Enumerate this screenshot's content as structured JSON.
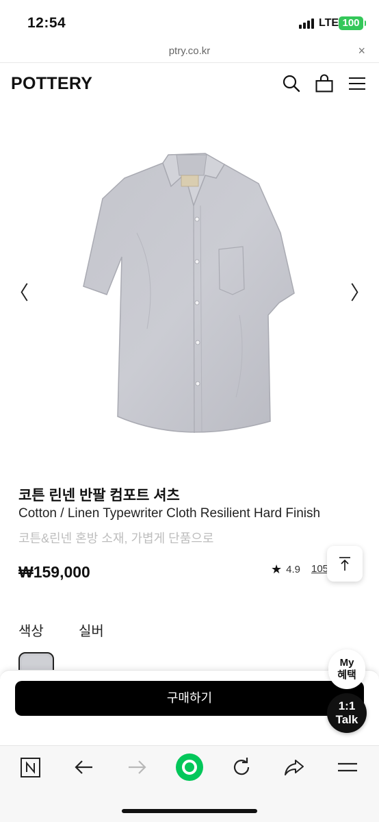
{
  "status_bar": {
    "time": "12:54",
    "network": "LTE",
    "battery": "100"
  },
  "url_bar": {
    "url": "ptry.co.kr",
    "close_symbol": "×"
  },
  "header": {
    "logo": "POTTERY",
    "icons": [
      "search-icon",
      "shopping-bag-icon",
      "menu-icon"
    ]
  },
  "gallery": {
    "prev_symbol": "〈",
    "next_symbol": "〉",
    "image_description_icon": "shirt-product-image"
  },
  "product": {
    "name_kr": "코튼 린넨 반팔 컴포트 셔츠",
    "name_en": "Cotton / Linen Typewriter Cloth Resilient Hard Finish",
    "description": "코튼&린넨 혼방 소재, 가볍게 단품으로",
    "price": "₩159,000",
    "rating": "4.9",
    "review_count": "105"
  },
  "options": {
    "color_label": "색상",
    "color_value": "실버",
    "swatch_color": "#c9cacf"
  },
  "purchase": {
    "buy_label": "구매하기",
    "my_benefit_line1": "My",
    "my_benefit_line2": "혜택",
    "talk_line1": "1:1",
    "talk_line2": "Talk"
  },
  "browser_toolbar": {
    "items": [
      "naver-n-icon",
      "back-arrow-icon",
      "forward-arrow-icon",
      "green-home-icon",
      "reload-icon",
      "share-icon",
      "menu-icon"
    ],
    "accent_color": "#03c75a"
  }
}
